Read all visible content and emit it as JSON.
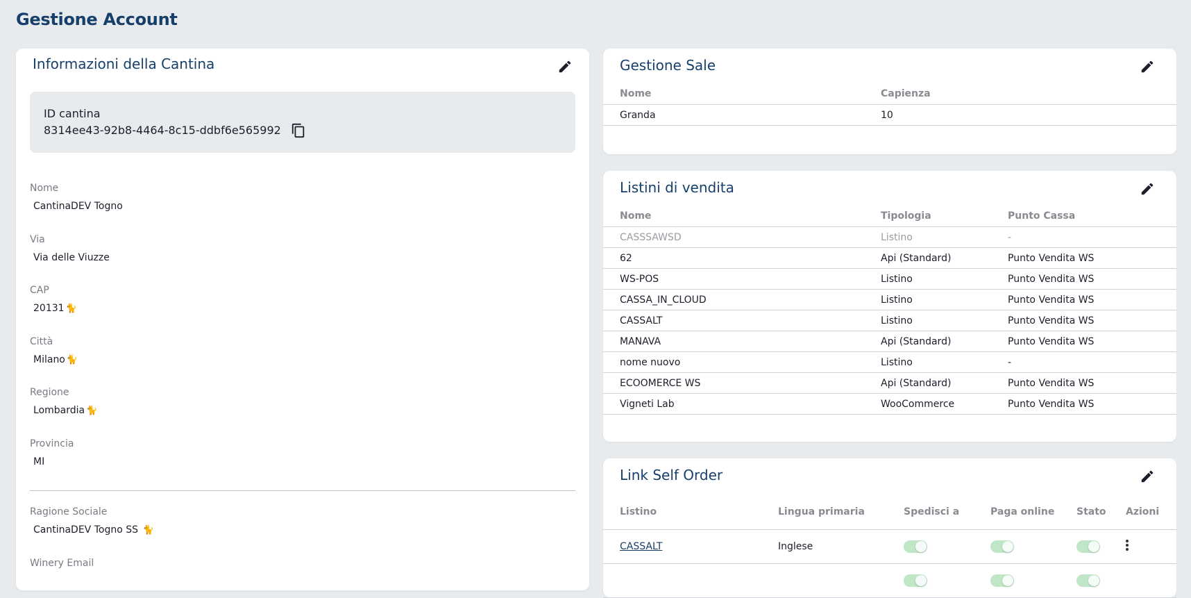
{
  "page": {
    "title": "Gestione Account"
  },
  "colors": {
    "accent": "#173f6b",
    "background": "#e8ebee",
    "toggle_on": "#bfe6c6"
  },
  "cantina": {
    "title": "Informazioni della Cantina",
    "id_label": "ID cantina",
    "id_value": "8314ee43-92b8-4464-8c15-ddbf6e565992",
    "fields": {
      "nome": {
        "label": "Nome",
        "value": "CantinaDEV Togno"
      },
      "via": {
        "label": "Via",
        "value": "Via delle Viuzze"
      },
      "cap": {
        "label": "CAP",
        "value": "20131",
        "emoji": "🐈"
      },
      "citta": {
        "label": "Città",
        "value": "Milano",
        "emoji": "🐈"
      },
      "regione": {
        "label": "Regione",
        "value": "Lombardia",
        "emoji": "🐈"
      },
      "provincia": {
        "label": "Provincia",
        "value": "MI"
      },
      "ragione_sociale": {
        "label": "Ragione Sociale",
        "value": "CantinaDEV Togno SS",
        "emoji": "🐈"
      },
      "winery_email": {
        "label": "Winery Email"
      }
    }
  },
  "sale": {
    "title": "Gestione Sale",
    "columns": [
      "Nome",
      "Capienza"
    ],
    "rows": [
      {
        "nome": "Granda",
        "capienza": "10"
      }
    ]
  },
  "listini": {
    "title": "Listini di vendita",
    "columns": [
      "Nome",
      "Tipologia",
      "Punto Cassa"
    ],
    "rows": [
      {
        "nome": "CASSSAWSD",
        "tipologia": "Listino",
        "punto_cassa": "-"
      },
      {
        "nome": "62",
        "tipologia": "Api (Standard)",
        "punto_cassa": "Punto Vendita WS"
      },
      {
        "nome": "WS-POS",
        "tipologia": "Listino",
        "punto_cassa": "Punto Vendita WS"
      },
      {
        "nome": "CASSA_IN_CLOUD",
        "tipologia": "Listino",
        "punto_cassa": "Punto Vendita WS"
      },
      {
        "nome": "CASSALT",
        "tipologia": "Listino",
        "punto_cassa": "Punto Vendita WS"
      },
      {
        "nome": "MANAVA",
        "tipologia": "Api (Standard)",
        "punto_cassa": "Punto Vendita WS"
      },
      {
        "nome": "nome nuovo",
        "tipologia": "Listino",
        "punto_cassa": "-"
      },
      {
        "nome": "ECOOMERCE WS",
        "tipologia": "Api (Standard)",
        "punto_cassa": "Punto Vendita WS"
      },
      {
        "nome": "Vigneti Lab",
        "tipologia": "WooCommerce",
        "punto_cassa": "Punto Vendita WS"
      }
    ]
  },
  "link_self_order": {
    "title": "Link Self Order",
    "columns": [
      "Listino",
      "Lingua primaria",
      "Spedisci a",
      "Paga online",
      "Stato",
      "Azioni"
    ],
    "rows": [
      {
        "listino": "CASSALT",
        "lingua": "Inglese",
        "spedisci": true,
        "paga_online": true,
        "stato": true
      }
    ]
  }
}
